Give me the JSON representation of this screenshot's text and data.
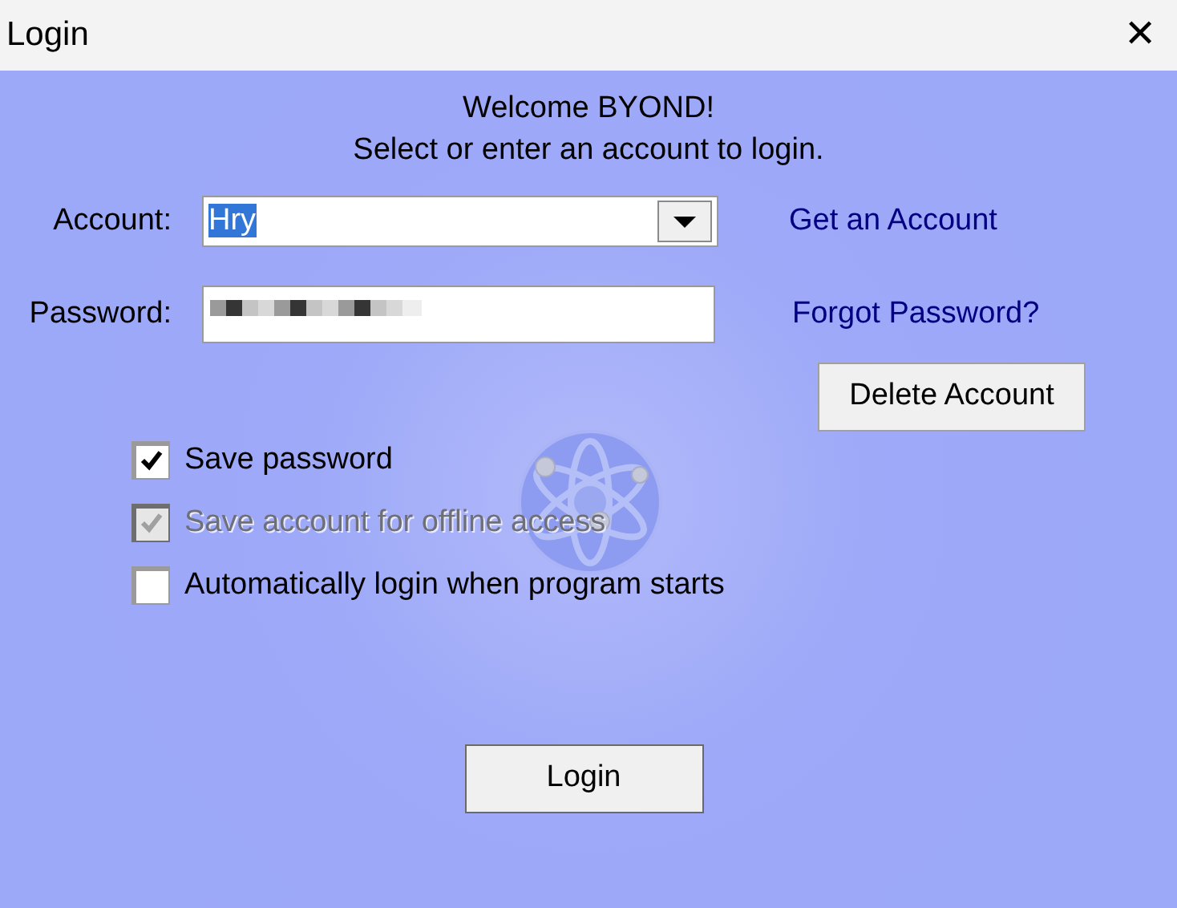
{
  "window": {
    "title": "Login",
    "close": "✕"
  },
  "heading": [
    "Welcome BYOND!",
    "Select or enter an account to login."
  ],
  "account": {
    "label": "Account:",
    "value": "Hry",
    "selected_text": true
  },
  "password": {
    "label": "Password:"
  },
  "links": [
    "Get an Account",
    "Forgot Password?"
  ],
  "delete_button": "Delete Account",
  "options": [
    {
      "label": "Save password",
      "checked": true,
      "disabled": false
    },
    {
      "label": "Save account for offline access",
      "checked": true,
      "disabled": true
    },
    {
      "label": "Automatically login when program starts",
      "checked": false,
      "disabled": false
    }
  ],
  "login_button": "Login"
}
